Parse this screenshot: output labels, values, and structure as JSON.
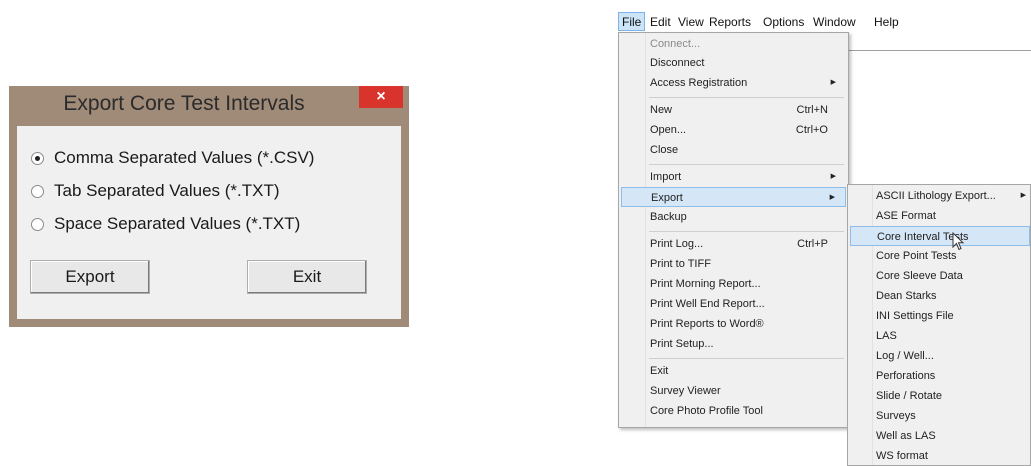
{
  "dialog": {
    "title": "Export Core Test Intervals",
    "close_glyph": "×",
    "options": [
      {
        "label": "Comma Separated Values (*.CSV)",
        "checked": true
      },
      {
        "label": "Tab Separated Values (*.TXT)",
        "checked": false
      },
      {
        "label": "Space Separated Values (*.TXT)",
        "checked": false
      }
    ],
    "export_label": "Export",
    "exit_label": "Exit"
  },
  "menubar": {
    "items": [
      "File",
      "Edit",
      "View",
      "Reports",
      "Options",
      "Window",
      "Help"
    ],
    "active": "File"
  },
  "file_menu": {
    "items": [
      {
        "label": "Connect...",
        "disabled": true
      },
      {
        "label": "Disconnect"
      },
      {
        "label": "Access Registration",
        "arrow": "▶"
      },
      {
        "label": "New",
        "shortcut": "Ctrl+N"
      },
      {
        "label": "Open...",
        "shortcut": "Ctrl+O"
      },
      {
        "label": "Close"
      },
      {
        "label": "Import",
        "arrow": "▶"
      },
      {
        "label": "Export",
        "arrow": "▶",
        "highlighted": true
      },
      {
        "label": "Backup"
      },
      {
        "label": "Print Log...",
        "shortcut": "Ctrl+P"
      },
      {
        "label": "Print to TIFF"
      },
      {
        "label": "Print Morning Report..."
      },
      {
        "label": "Print Well End Report..."
      },
      {
        "label": "Print Reports to Word®"
      },
      {
        "label": "Print Setup..."
      },
      {
        "label": "Exit"
      },
      {
        "label": "Survey Viewer"
      },
      {
        "label": "Core Photo Profile Tool"
      }
    ]
  },
  "export_submenu": {
    "items": [
      {
        "label": "ASCII Lithology Export...",
        "arrow": "▶"
      },
      {
        "label": "ASE Format"
      },
      {
        "label": "Core Interval Tests",
        "highlighted": true
      },
      {
        "label": "Core Point Tests"
      },
      {
        "label": "Core Sleeve Data"
      },
      {
        "label": "Dean Starks"
      },
      {
        "label": "INI Settings File"
      },
      {
        "label": "LAS"
      },
      {
        "label": "Log / Well..."
      },
      {
        "label": "Perforations"
      },
      {
        "label": "Slide / Rotate"
      },
      {
        "label": "Surveys"
      },
      {
        "label": "Well as LAS"
      },
      {
        "label": "WS format"
      }
    ]
  }
}
